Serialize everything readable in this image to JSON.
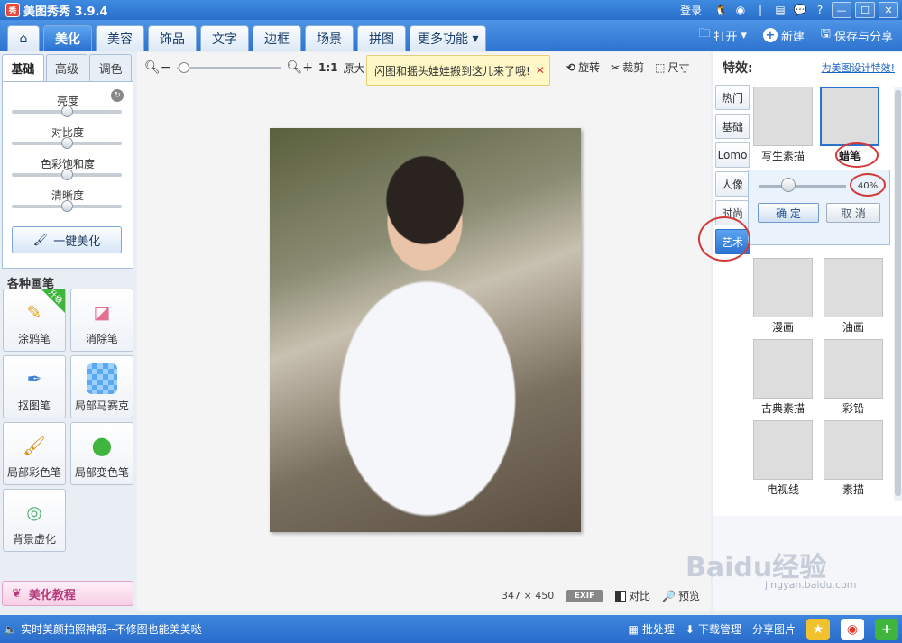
{
  "titlebar": {
    "app_title": "美图秀秀 3.9.4",
    "login": "登录",
    "window_controls": [
      "minimize",
      "maximize",
      "close"
    ]
  },
  "tabs": [
    "美化",
    "美容",
    "饰品",
    "文字",
    "边框",
    "场景",
    "拼图",
    "更多功能"
  ],
  "active_tab": "美化",
  "header_actions": {
    "open": "打开",
    "new": "新建",
    "save_share": "保存与分享"
  },
  "left": {
    "subtabs": [
      "基础",
      "高级",
      "调色"
    ],
    "sliders": [
      {
        "label": "亮度",
        "level": 0.5
      },
      {
        "label": "对比度",
        "level": 0.5
      },
      {
        "label": "色彩饱和度",
        "level": 0.5
      },
      {
        "label": "清晰度",
        "level": 0.5
      }
    ],
    "onekey": "一键美化",
    "brush_title": "各种画笔",
    "brushes": [
      "涂鸦笔",
      "消除笔",
      "抠图笔",
      "局部马赛克",
      "局部彩色笔",
      "局部变色笔",
      "背景虚化"
    ],
    "upgrade_badge": "升级",
    "tutorial": "美化教程"
  },
  "center": {
    "zoom_label": "1:1",
    "original_size": "原大",
    "notice": "闪图和摇头娃娃搬到这儿来了哦!",
    "tools": [
      "旋转",
      "裁剪",
      "尺寸"
    ],
    "image_width": "347",
    "image_times": "×",
    "image_height": "450",
    "exif": "EXIF",
    "compare": "对比",
    "preview": "预览"
  },
  "right": {
    "title": "特效:",
    "design_link": "为美图设计特效!",
    "categories": [
      "热门",
      "基础",
      "Lomo",
      "人像",
      "时尚",
      "艺术"
    ],
    "active_category": "艺术",
    "effects_top": [
      "写生素描",
      "蜡笔"
    ],
    "selected_effect": "蜡笔",
    "intensity": "40%",
    "ok": "确 定",
    "cancel": "取 消",
    "effects_grid": [
      "漫画",
      "油画",
      "古典素描",
      "彩铅",
      "电视线",
      "素描"
    ]
  },
  "status": {
    "message": "实时美颜拍照神器--不修图也能美美哒",
    "batch": "批处理",
    "download": "下载管理",
    "share": "分享图片"
  },
  "watermark": {
    "logo": "Baidu经验",
    "url": "jingyan.baidu.com"
  }
}
